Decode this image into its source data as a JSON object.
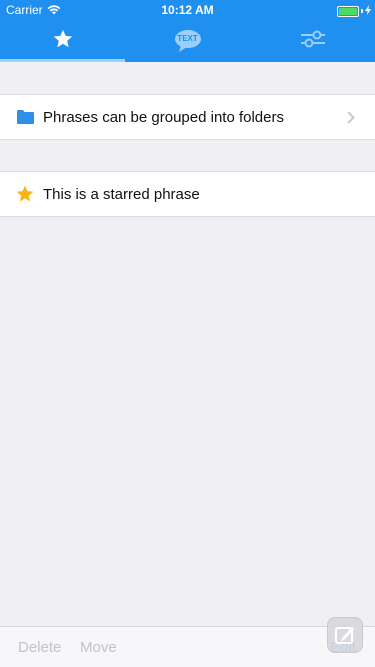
{
  "status_bar": {
    "carrier": "Carrier",
    "time": "10:12 AM",
    "icons": [
      "wifi-icon",
      "battery-icon",
      "charging-icon"
    ]
  },
  "tabs": [
    {
      "name": "favorites",
      "icon": "star-icon",
      "selected": true
    },
    {
      "name": "phrases",
      "icon": "text-bubble-icon",
      "icon_text": "TEXT",
      "selected": false
    },
    {
      "name": "settings",
      "icon": "sliders-icon",
      "selected": false
    }
  ],
  "rows": [
    {
      "icon": "folder-icon",
      "label": "Phrases can be grouped into folders",
      "has_chevron": true
    },
    {
      "icon": "star-icon",
      "label": "This is a starred phrase",
      "has_chevron": false
    }
  ],
  "toolbar": {
    "delete_label": "Delete",
    "move_label": "Move",
    "edit_label": "Edit"
  },
  "colors": {
    "accent": "#1f8ff0",
    "star": "#f5b61a",
    "disabled_text": "#c3c3c8",
    "background": "#efeff4"
  }
}
